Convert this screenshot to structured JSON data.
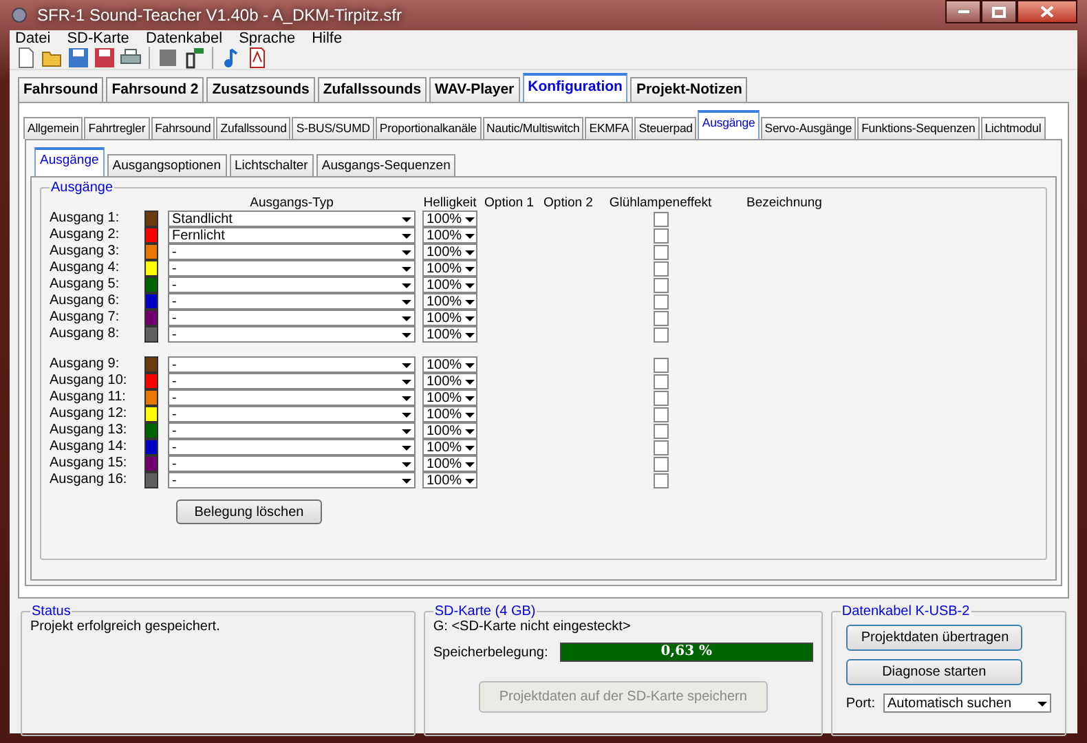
{
  "window": {
    "title": "SFR-1 Sound-Teacher V1.40b - A_DKM-Tirpitz.sfr"
  },
  "menu": [
    "Datei",
    "SD-Karte",
    "Datenkabel",
    "Sprache",
    "Hilfe"
  ],
  "main_tabs": [
    {
      "label": "Fahrsound",
      "selected": false
    },
    {
      "label": "Fahrsound 2",
      "selected": false
    },
    {
      "label": "Zusatzsounds",
      "selected": false
    },
    {
      "label": "Zufallssounds",
      "selected": false
    },
    {
      "label": "WAV-Player",
      "selected": false
    },
    {
      "label": "Konfiguration",
      "selected": true
    },
    {
      "label": "Projekt-Notizen",
      "selected": false
    }
  ],
  "sub_tabs": [
    {
      "label": "Allgemein",
      "selected": false
    },
    {
      "label": "Fahrtregler",
      "selected": false
    },
    {
      "label": "Fahrsound",
      "selected": false
    },
    {
      "label": "Zufallssound",
      "selected": false
    },
    {
      "label": "S-BUS/SUMD",
      "selected": false
    },
    {
      "label": "Proportionalkanäle",
      "selected": false
    },
    {
      "label": "Nautic/Multiswitch",
      "selected": false
    },
    {
      "label": "EKMFA",
      "selected": false
    },
    {
      "label": "Steuerpad",
      "selected": false
    },
    {
      "label": "Ausgänge",
      "selected": true
    },
    {
      "label": "Servo-Ausgänge",
      "selected": false
    },
    {
      "label": "Funktions-Sequenzen",
      "selected": false
    },
    {
      "label": "Lichtmodul",
      "selected": false
    }
  ],
  "output_tabs": [
    {
      "label": "Ausgänge",
      "selected": true
    },
    {
      "label": "Ausgangsoptionen",
      "selected": false
    },
    {
      "label": "Lichtschalter",
      "selected": false
    },
    {
      "label": "Ausgangs-Sequenzen",
      "selected": false
    }
  ],
  "outputs": {
    "title": "Ausgänge",
    "columns": [
      "Ausgangs-Typ",
      "Helligkeit",
      "Option 1",
      "Option 2",
      "Glühlampeneffekt",
      "Bezeichnung"
    ],
    "groups": [
      [
        {
          "label": "Ausgang 1:",
          "color": "#6b3a10",
          "type": "Standlicht",
          "brightness": "100%",
          "checked": false
        },
        {
          "label": "Ausgang 2:",
          "color": "#ff0000",
          "type": "Fernlicht",
          "brightness": "100%",
          "checked": false
        },
        {
          "label": "Ausgang 3:",
          "color": "#e87800",
          "type": "-",
          "brightness": "100%",
          "checked": false
        },
        {
          "label": "Ausgang 4:",
          "color": "#ffff00",
          "type": "-",
          "brightness": "100%",
          "checked": false
        },
        {
          "label": "Ausgang 5:",
          "color": "#006400",
          "type": "-",
          "brightness": "100%",
          "checked": false
        },
        {
          "label": "Ausgang 6:",
          "color": "#0000c0",
          "type": "-",
          "brightness": "100%",
          "checked": false
        },
        {
          "label": "Ausgang 7:",
          "color": "#700070",
          "type": "-",
          "brightness": "100%",
          "checked": false
        },
        {
          "label": "Ausgang 8:",
          "color": "#606060",
          "type": "-",
          "brightness": "100%",
          "checked": false
        }
      ],
      [
        {
          "label": "Ausgang 9:",
          "color": "#6b3a10",
          "type": "-",
          "brightness": "100%",
          "checked": false
        },
        {
          "label": "Ausgang 10:",
          "color": "#ff0000",
          "type": "-",
          "brightness": "100%",
          "checked": false
        },
        {
          "label": "Ausgang 11:",
          "color": "#e87800",
          "type": "-",
          "brightness": "100%",
          "checked": false
        },
        {
          "label": "Ausgang 12:",
          "color": "#ffff00",
          "type": "-",
          "brightness": "100%",
          "checked": false
        },
        {
          "label": "Ausgang 13:",
          "color": "#006400",
          "type": "-",
          "brightness": "100%",
          "checked": false
        },
        {
          "label": "Ausgang 14:",
          "color": "#0000c0",
          "type": "-",
          "brightness": "100%",
          "checked": false
        },
        {
          "label": "Ausgang 15:",
          "color": "#700070",
          "type": "-",
          "brightness": "100%",
          "checked": false
        },
        {
          "label": "Ausgang 16:",
          "color": "#606060",
          "type": "-",
          "brightness": "100%",
          "checked": false
        }
      ]
    ],
    "clear_button": "Belegung löschen"
  },
  "status": {
    "title": "Status",
    "message": "Projekt erfolgreich gespeichert."
  },
  "sd_card": {
    "title": "SD-Karte (4 GB)",
    "drive": "G: <SD-Karte nicht eingesteckt>",
    "usage_label": "Speicherbelegung:",
    "usage_reading": "0,63 %",
    "save_button": "Projektdaten auf der SD-Karte speichern",
    "save_disabled": true
  },
  "cable": {
    "title": "Datenkabel K-USB-2",
    "buttons": [
      "Projektdaten übertragen",
      "Diagnose starten"
    ],
    "port_label": "Port:",
    "port_value": "Automatisch suchen"
  }
}
